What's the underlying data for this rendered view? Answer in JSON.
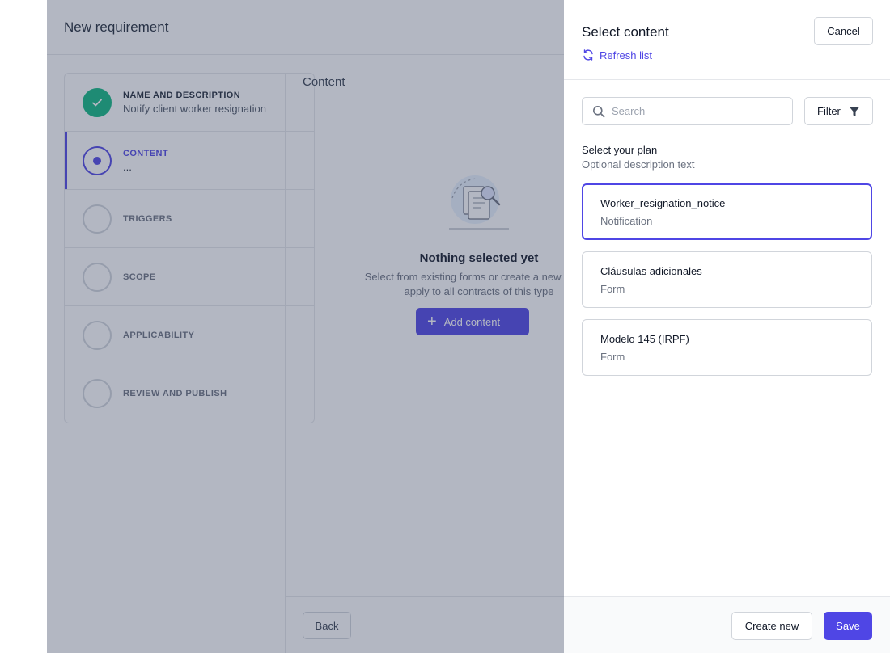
{
  "page": {
    "title": "New requirement"
  },
  "stepper": {
    "steps": [
      {
        "label": "NAME AND DESCRIPTION",
        "sub": "Notify client worker resignation",
        "state": "done"
      },
      {
        "label": "CONTENT",
        "sub": "...",
        "state": "current"
      },
      {
        "label": "TRIGGERS",
        "sub": "",
        "state": "pending"
      },
      {
        "label": "SCOPE",
        "sub": "",
        "state": "pending"
      },
      {
        "label": "APPLICABILITY",
        "sub": "",
        "state": "pending"
      },
      {
        "label": "REVIEW AND PUBLISH",
        "sub": "",
        "state": "pending"
      }
    ]
  },
  "content": {
    "title": "Content",
    "empty_title": "Nothing selected yet",
    "empty_desc_line1": "Select from existing forms or create a new one to",
    "empty_desc_line2": "apply to all contracts of this type",
    "add_label": "Add content",
    "add_icon": "plus-icon"
  },
  "footer": {
    "back_label": "Back"
  },
  "drawer": {
    "title": "Select content",
    "refresh_label": "Refresh list",
    "refresh_icon": "refresh-icon",
    "cancel_label": "Cancel",
    "search": {
      "placeholder": "Search",
      "value": "",
      "icon": "search-icon"
    },
    "filter_label": "Filter",
    "filter_icon": "funnel-icon",
    "plan_label": "Select your plan",
    "plan_desc": "Optional description text",
    "options": [
      {
        "title": "Worker_resignation_notice",
        "type": "Notification",
        "selected": true
      },
      {
        "title": "Cláusulas adicionales",
        "type": "Form",
        "selected": false
      },
      {
        "title": "Modelo 145 (IRPF)",
        "type": "Form",
        "selected": false
      }
    ],
    "create_label": "Create new",
    "save_label": "Save"
  },
  "colors": {
    "accent": "#4f46e5",
    "success": "#10b981",
    "overlay": "#37415f"
  }
}
